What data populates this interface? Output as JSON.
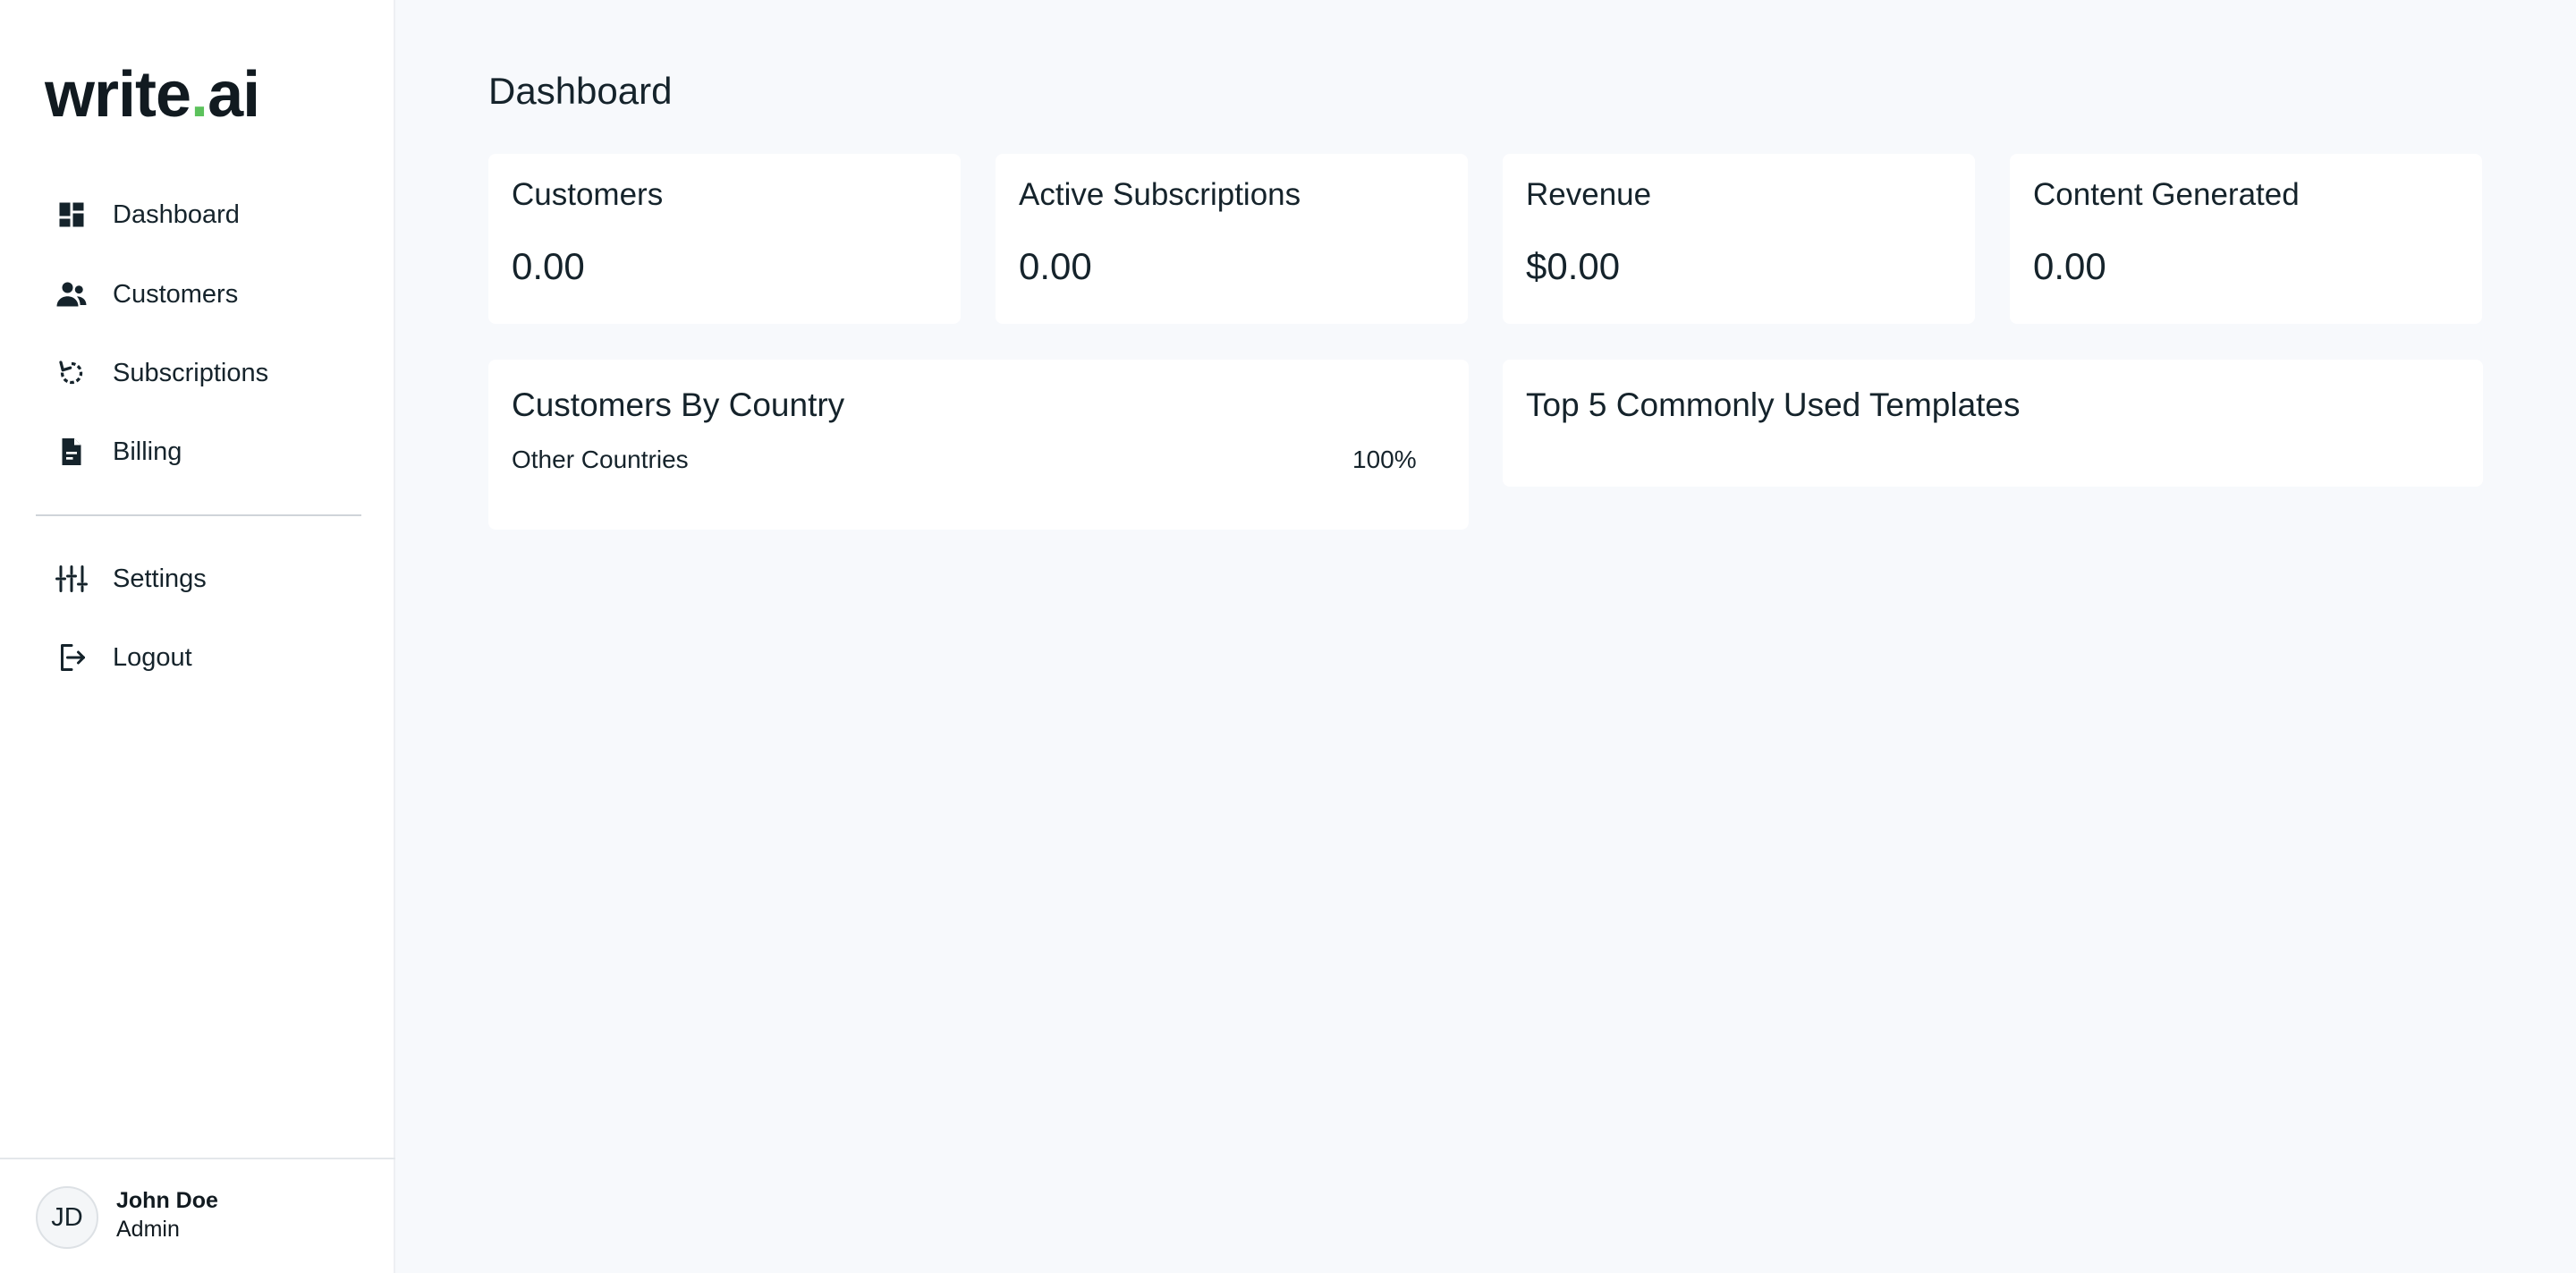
{
  "app": {
    "logo_main": "write",
    "logo_dot": ".",
    "logo_suffix": "ai"
  },
  "sidebar": {
    "items": [
      {
        "label": "Dashboard",
        "icon": "dashboard-icon"
      },
      {
        "label": "Customers",
        "icon": "users-icon"
      },
      {
        "label": "Subscriptions",
        "icon": "refresh-icon"
      },
      {
        "label": "Billing",
        "icon": "document-icon"
      }
    ],
    "secondary_items": [
      {
        "label": "Settings",
        "icon": "sliders-icon"
      },
      {
        "label": "Logout",
        "icon": "logout-icon"
      }
    ]
  },
  "user": {
    "initials": "JD",
    "name": "John Doe",
    "role": "Admin"
  },
  "main": {
    "title": "Dashboard",
    "stats": [
      {
        "title": "Customers",
        "value": "0.00"
      },
      {
        "title": "Active Subscriptions",
        "value": "0.00"
      },
      {
        "title": "Revenue",
        "value": "$0.00"
      },
      {
        "title": "Content Generated",
        "value": "0.00"
      }
    ],
    "customers_by_country": {
      "title": "Customers By Country",
      "rows": [
        {
          "country": "Other Countries",
          "percent": "100%"
        }
      ]
    },
    "top_templates": {
      "title": "Top 5 Commonly Used Templates"
    }
  },
  "colors": {
    "accent_dot": "#5cc25c",
    "text": "#15232b",
    "background": "#f7f9fc",
    "card": "#ffffff"
  }
}
